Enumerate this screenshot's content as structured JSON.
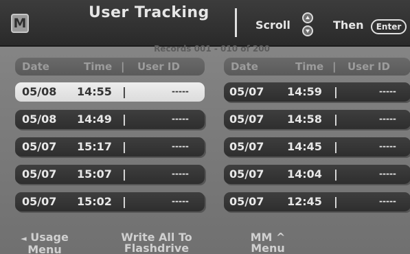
{
  "header": {
    "logo": "M",
    "title": "User Tracking",
    "scroll_label": "Scroll",
    "then_label": "Then",
    "enter_label": "Enter"
  },
  "records_label": "Records 001 - 010 of 200",
  "columns": {
    "date": "Date",
    "time": "Time",
    "sep": "|",
    "user_id": "User ID"
  },
  "left_rows": [
    {
      "date": "05/08",
      "time": "14:55",
      "sep": "|",
      "user_id": "-----"
    },
    {
      "date": "05/08",
      "time": "14:49",
      "sep": "|",
      "user_id": "-----"
    },
    {
      "date": "05/07",
      "time": "15:17",
      "sep": "|",
      "user_id": "-----"
    },
    {
      "date": "05/07",
      "time": "15:07",
      "sep": "|",
      "user_id": "-----"
    },
    {
      "date": "05/07",
      "time": "15:02",
      "sep": "|",
      "user_id": "-----"
    }
  ],
  "right_rows": [
    {
      "date": "05/07",
      "time": "14:59",
      "sep": "|",
      "user_id": "-----"
    },
    {
      "date": "05/07",
      "time": "14:58",
      "sep": "|",
      "user_id": "-----"
    },
    {
      "date": "05/07",
      "time": "14:45",
      "sep": "|",
      "user_id": "-----"
    },
    {
      "date": "05/07",
      "time": "14:04",
      "sep": "|",
      "user_id": "-----"
    },
    {
      "date": "05/07",
      "time": "12:45",
      "sep": "|",
      "user_id": "-----"
    }
  ],
  "footer": {
    "usage_arrow": "◄",
    "usage_line1": "Usage",
    "usage_line2": "Menu",
    "write_line1": "Write All To",
    "write_line2": "Flashdrive",
    "mm_line1": "MM",
    "mm_arrow": "^",
    "mm_line2": "Menu"
  },
  "colors": {
    "header_bg": "#2f2f2f",
    "row_bg": "#353535",
    "row_selected_bg": "#e6e6e6",
    "screen_bg": "#7e7e7e"
  }
}
